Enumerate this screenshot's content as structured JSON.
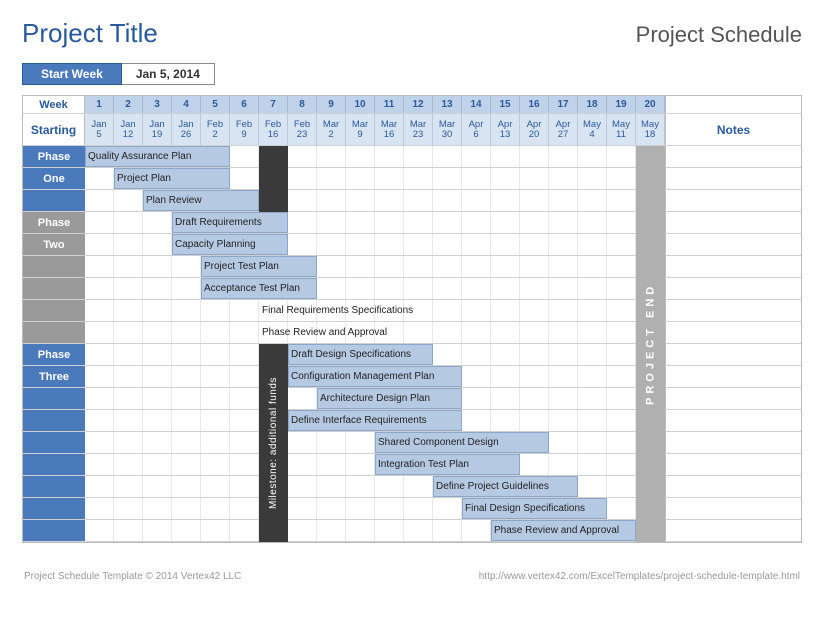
{
  "title": "Project Title",
  "subtitle": "Project Schedule",
  "startweek_label": "Start Week",
  "startweek_value": "Jan 5, 2014",
  "header": {
    "week_label": "Week",
    "starting_label": "Starting",
    "notes_label": "Notes"
  },
  "weeks": [
    {
      "n": "1",
      "m": "Jan",
      "d": "5"
    },
    {
      "n": "2",
      "m": "Jan",
      "d": "12"
    },
    {
      "n": "3",
      "m": "Jan",
      "d": "19"
    },
    {
      "n": "4",
      "m": "Jan",
      "d": "26"
    },
    {
      "n": "5",
      "m": "Feb",
      "d": "2"
    },
    {
      "n": "6",
      "m": "Feb",
      "d": "9"
    },
    {
      "n": "7",
      "m": "Feb",
      "d": "16"
    },
    {
      "n": "8",
      "m": "Feb",
      "d": "23"
    },
    {
      "n": "9",
      "m": "Mar",
      "d": "2"
    },
    {
      "n": "10",
      "m": "Mar",
      "d": "9"
    },
    {
      "n": "11",
      "m": "Mar",
      "d": "16"
    },
    {
      "n": "12",
      "m": "Mar",
      "d": "23"
    },
    {
      "n": "13",
      "m": "Mar",
      "d": "30"
    },
    {
      "n": "14",
      "m": "Apr",
      "d": "6"
    },
    {
      "n": "15",
      "m": "Apr",
      "d": "13"
    },
    {
      "n": "16",
      "m": "Apr",
      "d": "20"
    },
    {
      "n": "17",
      "m": "Apr",
      "d": "27"
    },
    {
      "n": "18",
      "m": "May",
      "d": "4"
    },
    {
      "n": "19",
      "m": "May",
      "d": "11"
    },
    {
      "n": "20",
      "m": "May",
      "d": "18"
    }
  ],
  "chart_data": {
    "type": "bar",
    "title": "Project Schedule",
    "xlabel": "Week",
    "categories": [
      1,
      2,
      3,
      4,
      5,
      6,
      7,
      8,
      9,
      10,
      11,
      12,
      13,
      14,
      15,
      16,
      17,
      18,
      19,
      20
    ],
    "milestone": {
      "week": 7,
      "label": "Milestone: additional funds"
    },
    "project_end": {
      "week": 20,
      "label": "PROJECT END"
    },
    "phases": [
      {
        "name": "Phase One",
        "label_lines": [
          "Phase",
          "One"
        ],
        "label_style": "blue",
        "row_span": 3,
        "tasks": [
          {
            "name": "Quality Assurance Plan",
            "start": 1,
            "end": 5
          },
          {
            "name": "Project Plan",
            "start": 2,
            "end": 5
          },
          {
            "name": "Plan Review",
            "start": 3,
            "end": 6
          }
        ]
      },
      {
        "name": "Phase Two",
        "label_lines": [
          "Phase",
          "Two"
        ],
        "label_style": "gray",
        "row_span": 6,
        "tasks": [
          {
            "name": "Draft Requirements",
            "start": 4,
            "end": 7
          },
          {
            "name": "Capacity Planning",
            "start": 4,
            "end": 7
          },
          {
            "name": "Project Test Plan",
            "start": 5,
            "end": 8
          },
          {
            "name": "Acceptance Test Plan",
            "start": 5,
            "end": 8
          },
          {
            "name": "Final Requirements Specifications",
            "start": 7,
            "end": 12,
            "nobar": true
          },
          {
            "name": "Phase Review and Approval",
            "start": 7,
            "end": 11,
            "nobar": true
          }
        ]
      },
      {
        "name": "Phase Three",
        "label_lines": [
          "Phase",
          "Three"
        ],
        "label_style": "blue",
        "row_span": 9,
        "tasks": [
          {
            "name": "Draft Design Specifications",
            "start": 8,
            "end": 12
          },
          {
            "name": "Configuration Management Plan",
            "start": 8,
            "end": 13
          },
          {
            "name": "Architecture Design Plan",
            "start": 9,
            "end": 13
          },
          {
            "name": "Define Interface Requirements",
            "start": 8,
            "end": 13
          },
          {
            "name": "Shared Component Design",
            "start": 11,
            "end": 16
          },
          {
            "name": "Integration Test Plan",
            "start": 11,
            "end": 15
          },
          {
            "name": "Define Project Guidelines",
            "start": 13,
            "end": 17
          },
          {
            "name": "Final Design Specifications",
            "start": 14,
            "end": 18
          },
          {
            "name": "Phase Review and Approval",
            "start": 15,
            "end": 19
          }
        ]
      }
    ]
  },
  "footer": {
    "left": "Project Schedule Template © 2014 Vertex42 LLC",
    "right": "http://www.vertex42.com/ExcelTemplates/project-schedule-template.html"
  }
}
